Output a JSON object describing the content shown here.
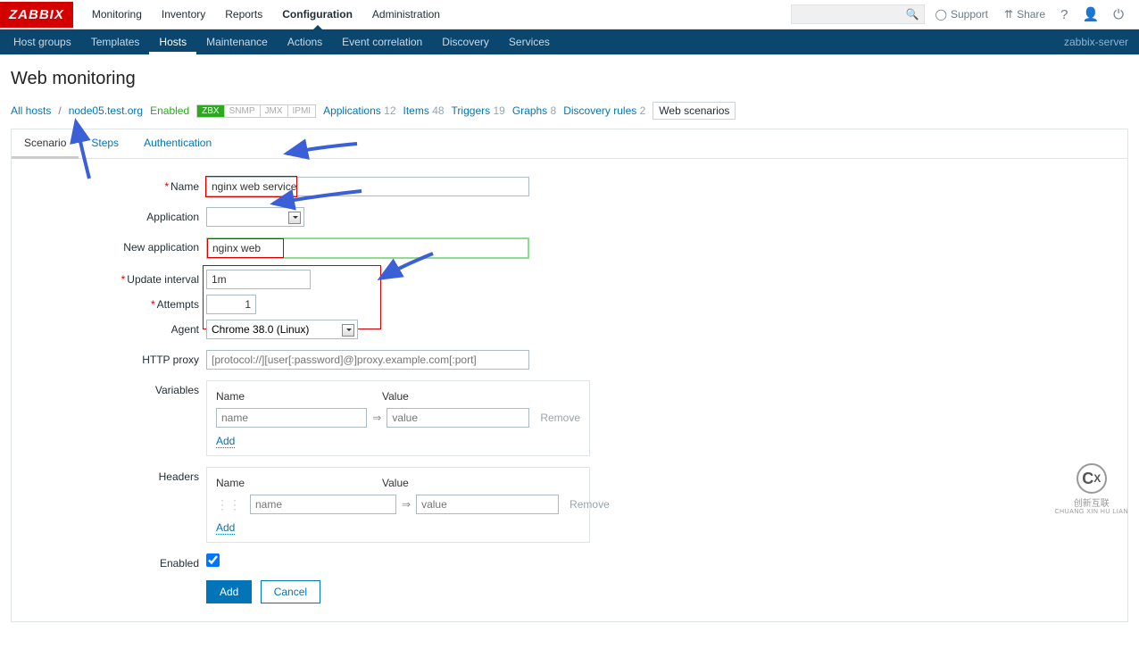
{
  "logo": "ZABBIX",
  "topnav": [
    "Monitoring",
    "Inventory",
    "Reports",
    "Configuration",
    "Administration"
  ],
  "topnav_active": "Configuration",
  "topright": {
    "support": "Support",
    "share": "Share"
  },
  "subnav": [
    "Host groups",
    "Templates",
    "Hosts",
    "Maintenance",
    "Actions",
    "Event correlation",
    "Discovery",
    "Services"
  ],
  "subnav_active": "Hosts",
  "server_label": "zabbix-server",
  "page_title": "Web monitoring",
  "crumbs": {
    "all_hosts": "All hosts",
    "host": "node05.test.org",
    "enabled": "Enabled",
    "proto": [
      "ZBX",
      "SNMP",
      "JMX",
      "IPMI"
    ],
    "applications": {
      "label": "Applications",
      "count": "12"
    },
    "items": {
      "label": "Items",
      "count": "48"
    },
    "triggers": {
      "label": "Triggers",
      "count": "19"
    },
    "graphs": {
      "label": "Graphs",
      "count": "8"
    },
    "discovery": {
      "label": "Discovery rules",
      "count": "2"
    },
    "webscenarios": "Web scenarios"
  },
  "tabs": [
    "Scenario",
    "Steps",
    "Authentication"
  ],
  "tabs_active": "Scenario",
  "form": {
    "labels": {
      "name": "Name",
      "application": "Application",
      "new_application": "New application",
      "update_interval": "Update interval",
      "attempts": "Attempts",
      "agent": "Agent",
      "http_proxy": "HTTP proxy",
      "variables": "Variables",
      "headers": "Headers",
      "enabled": "Enabled"
    },
    "values": {
      "name": "nginx web service",
      "application": "",
      "new_application": "nginx web",
      "update_interval": "1m",
      "attempts": "1",
      "agent": "Chrome 38.0 (Linux)",
      "http_proxy": ""
    },
    "placeholders": {
      "http_proxy": "[protocol://][user[:password]@]proxy.example.com[:port]",
      "pair_name": "name",
      "pair_value": "value"
    },
    "pair_headers": {
      "name": "Name",
      "value": "Value"
    },
    "pair_actions": {
      "remove": "Remove",
      "add": "Add"
    },
    "enabled_checked": true,
    "buttons": {
      "add": "Add",
      "cancel": "Cancel"
    }
  },
  "footer": {
    "cn": "创新互联",
    "en": "CHUANG XIN HU LIAN"
  }
}
